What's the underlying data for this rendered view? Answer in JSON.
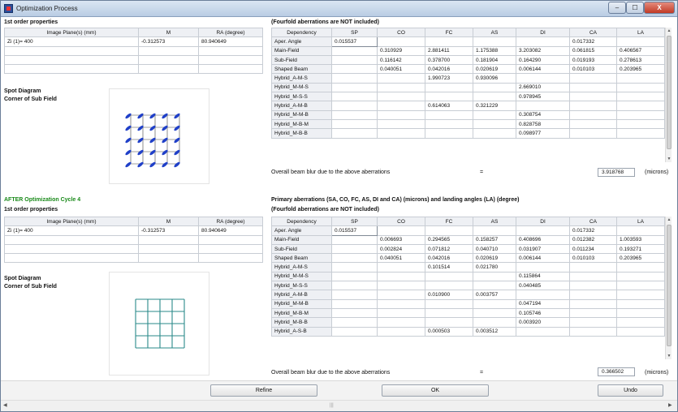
{
  "window": {
    "title": "Optimization Process"
  },
  "titlebar": {
    "min": "–",
    "max": "☐",
    "close": "X"
  },
  "top": {
    "section": "1st order properties",
    "props": {
      "headers": [
        "Image Plane(s) (mm)",
        "M",
        "RA (degree)"
      ],
      "rows": [
        [
          "Zi (1)= 400",
          "-0.312573",
          "80.940649"
        ]
      ]
    },
    "spot_title": "Spot Diagram",
    "spot_sub": "Corner of Sub Field",
    "aber_note": "(Fourfold aberrations are NOT included)",
    "aber": {
      "headers": [
        "Dependency",
        "SP",
        "CO",
        "FC",
        "AS",
        "DI",
        "CA",
        "LA"
      ],
      "rows": [
        [
          "Aper. Angle",
          "0.015537",
          "",
          "",
          "",
          "",
          "0.017332",
          ""
        ],
        [
          "Main-Field",
          "",
          "0.310929",
          "2.881411",
          "1.175388",
          "3.203082",
          "0.061815",
          "0.406567"
        ],
        [
          "Sub-Field",
          "",
          "0.116142",
          "0.378700",
          "0.181904",
          "0.164290",
          "0.019193",
          "0.278613"
        ],
        [
          "Shaped Beam",
          "",
          "0.040051",
          "0.042016",
          "0.020619",
          "0.006144",
          "0.010103",
          "0.203965"
        ],
        [
          "Hybrid_A-M-S",
          "",
          "",
          "1.990723",
          "0.930096",
          "",
          "",
          ""
        ],
        [
          "Hybrid_M-M-S",
          "",
          "",
          "",
          "",
          "2.669010",
          "",
          ""
        ],
        [
          "Hybrid_M-S-S",
          "",
          "",
          "",
          "",
          "0.978945",
          "",
          ""
        ],
        [
          "Hybrid_A-M-B",
          "",
          "",
          "0.614063",
          "0.321229",
          "",
          "",
          ""
        ],
        [
          "Hybrid_M-M-B",
          "",
          "",
          "",
          "",
          "0.308754",
          "",
          ""
        ],
        [
          "Hybrid_M-B-M",
          "",
          "",
          "",
          "",
          "0.828758",
          "",
          ""
        ],
        [
          "Hybrid_M-B-B",
          "",
          "",
          "",
          "",
          "0.098977",
          "",
          ""
        ]
      ]
    },
    "summary": {
      "label": "Overall beam blur due to the above aberrations",
      "eq": "=",
      "value": "3.918768",
      "unit": "(microns)"
    }
  },
  "bottom": {
    "cycle": "AFTER Optimization Cycle 4",
    "section": "1st order properties",
    "props": {
      "headers": [
        "Image Plane(s) (mm)",
        "M",
        "RA (degree)"
      ],
      "rows": [
        [
          "Zi (1)= 400",
          "-0.312573",
          "80.940649"
        ]
      ]
    },
    "spot_title": "Spot Diagram",
    "spot_sub": "Corner of Sub Field",
    "aber_title": "Primary aberrations (SA, CO, FC, AS, DI and CA) (microns) and landing angles (LA) (degree)",
    "aber_note": "(Fourfold aberrations are NOT included)",
    "aber": {
      "headers": [
        "Dependency",
        "SP",
        "CO",
        "FC",
        "AS",
        "DI",
        "CA",
        "LA"
      ],
      "rows": [
        [
          "Aper. Angle",
          "0.015537",
          "",
          "",
          "",
          "",
          "0.017332",
          ""
        ],
        [
          "Main-Field",
          "",
          "0.006693",
          "0.294565",
          "0.158257",
          "0.408696",
          "0.012382",
          "1.003593"
        ],
        [
          "Sub-Field",
          "",
          "0.002824",
          "0.071812",
          "0.040710",
          "0.031907",
          "0.011234",
          "0.193271"
        ],
        [
          "Shaped Beam",
          "",
          "0.040051",
          "0.042016",
          "0.020619",
          "0.006144",
          "0.010103",
          "0.203965"
        ],
        [
          "Hybrid_A-M-S",
          "",
          "",
          "0.101514",
          "0.021780",
          "",
          "",
          ""
        ],
        [
          "Hybrid_M-M-S",
          "",
          "",
          "",
          "",
          "0.115864",
          "",
          ""
        ],
        [
          "Hybrid_M-S-S",
          "",
          "",
          "",
          "",
          "0.040485",
          "",
          ""
        ],
        [
          "Hybrid_A-M-B",
          "",
          "",
          "0.010900",
          "0.003757",
          "",
          "",
          ""
        ],
        [
          "Hybrid_M-M-B",
          "",
          "",
          "",
          "",
          "0.047194",
          "",
          ""
        ],
        [
          "Hybrid_M-B-M",
          "",
          "",
          "",
          "",
          "0.105746",
          "",
          ""
        ],
        [
          "Hybrid_M-B-B",
          "",
          "",
          "",
          "",
          "0.003920",
          "",
          ""
        ],
        [
          "Hybrid_A-S-B",
          "",
          "",
          "0.000503",
          "0.003512",
          "",
          "",
          ""
        ]
      ]
    },
    "summary": {
      "label": "Overall beam blur due to the above aberrations",
      "eq": "=",
      "value": "0.366502",
      "unit": "(microns)"
    }
  },
  "buttons": {
    "refine": "Refine",
    "ok": "OK",
    "undo": "Undo"
  },
  "colors": {
    "spot_before": "#1f3fc8",
    "grid_after": "#2a8a8a",
    "cycle_label": "#1a8a1a"
  }
}
